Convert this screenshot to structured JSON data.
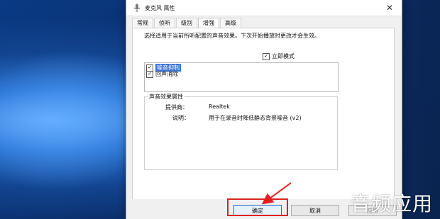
{
  "window": {
    "title": "麦克风 属性",
    "close_glyph": "✕"
  },
  "tabs": [
    {
      "label": "常规"
    },
    {
      "label": "侦听"
    },
    {
      "label": "级别"
    },
    {
      "label": "增强"
    },
    {
      "label": "高级"
    }
  ],
  "active_tab_index": 3,
  "enhancements": {
    "description": "选择适用于当前所听配置的声音效果。下次开始播放时更改才会生效。",
    "immediate_mode_label": "立即模式",
    "immediate_mode_checked": true,
    "items": [
      {
        "label": "噪音抑制",
        "checked": true,
        "selected": true
      },
      {
        "label": "回声消除",
        "checked": true,
        "selected": false
      }
    ]
  },
  "properties": {
    "group_title": "声音效果属性",
    "provider_label": "提供商：",
    "provider_value": "Realtek",
    "desc_label": "说明：",
    "desc_value": "用于在录音时降低静态背景噪音 (v2)"
  },
  "buttons": {
    "ok": "确定",
    "cancel": "取消",
    "apply": "应用"
  },
  "watermark": "音频应用",
  "colors": {
    "highlight": "#e02020",
    "selection": "#3b72d8"
  }
}
